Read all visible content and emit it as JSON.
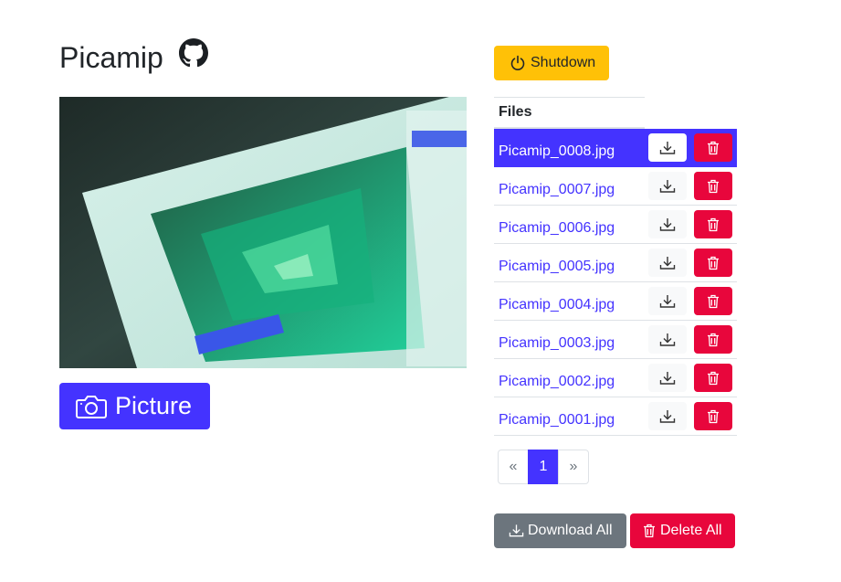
{
  "header": {
    "title": "Picamip",
    "github_icon": "github-icon"
  },
  "preview": {
    "alt": "camera preview"
  },
  "capture": {
    "label": "Picture",
    "icon": "camera-icon",
    "color": "#4433ff"
  },
  "shutdown": {
    "label": "Shutdown",
    "icon": "power-icon",
    "color": "#ffc107"
  },
  "files": {
    "header": "Files",
    "items": [
      {
        "name": "Picamip_0008.jpg"
      },
      {
        "name": "Picamip_0007.jpg"
      },
      {
        "name": "Picamip_0006.jpg"
      },
      {
        "name": "Picamip_0005.jpg"
      },
      {
        "name": "Picamip_0004.jpg"
      },
      {
        "name": "Picamip_0003.jpg"
      },
      {
        "name": "Picamip_0002.jpg"
      },
      {
        "name": "Picamip_0001.jpg"
      }
    ],
    "selected": "Picamip_0008.jpg"
  },
  "pagination": {
    "prev": "«",
    "current": "1",
    "next": "»"
  },
  "actions": {
    "download_all": "Download All",
    "delete_all": "Delete All",
    "danger_color": "#e8063c"
  }
}
